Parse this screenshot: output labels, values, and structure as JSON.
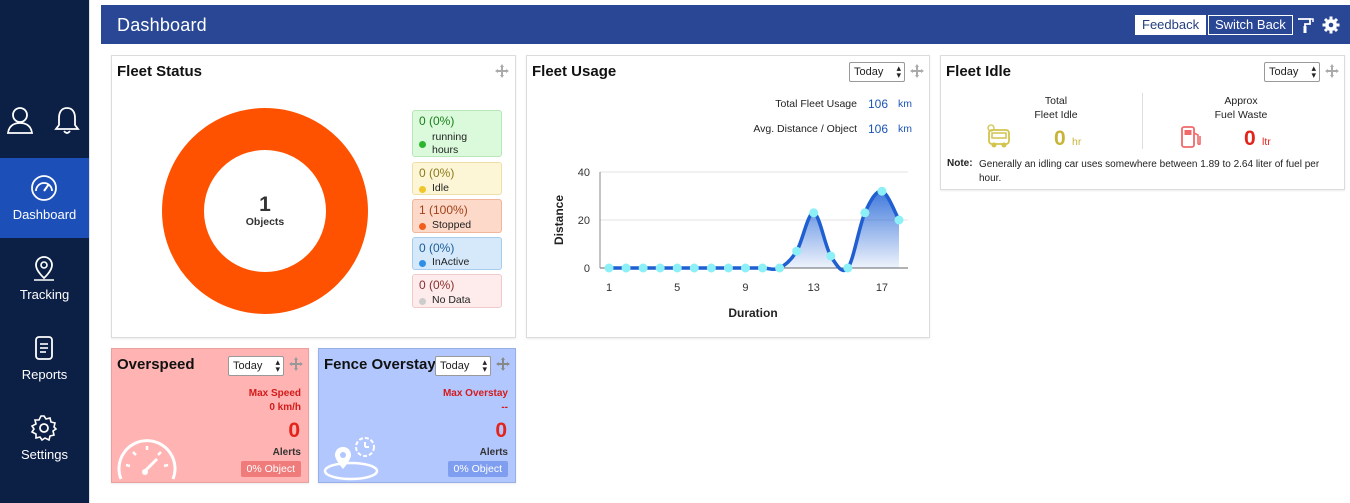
{
  "header": {
    "title": "Dashboard",
    "feedback_label": "Feedback",
    "switch_back_label": "Switch Back"
  },
  "sidebar": {
    "items": [
      {
        "label": "Dashboard",
        "icon": "gauge-icon"
      },
      {
        "label": "Tracking",
        "icon": "map-pin-icon"
      },
      {
        "label": "Reports",
        "icon": "document-icon"
      },
      {
        "label": "Settings",
        "icon": "gear-icon"
      }
    ]
  },
  "fleet_status": {
    "title": "Fleet Status",
    "center_value": "1",
    "center_label": "Objects",
    "legend": [
      {
        "value": "0 (0%)",
        "label": "running hours",
        "color": "#2db52d",
        "bg": "#dafadb"
      },
      {
        "value": "0 (0%)",
        "label": "Idle",
        "color": "#f1c628",
        "bg": "#fdf6d6"
      },
      {
        "value": "1 (100%)",
        "label": "Stopped",
        "color": "#f25d1a",
        "bg": "#fcd9c8"
      },
      {
        "value": "0 (0%)",
        "label": "InActive",
        "color": "#2f8ee8",
        "bg": "#d5e9fb"
      },
      {
        "value": "0 (0%)",
        "label": "No Data",
        "color": "#cccccc",
        "bg": "#fdeceb"
      }
    ]
  },
  "fleet_usage": {
    "title": "Fleet Usage",
    "period": "Today",
    "total_label": "Total Fleet Usage",
    "total_value": "106",
    "avg_label": "Avg. Distance / Object",
    "avg_value": "106",
    "unit": "km"
  },
  "fleet_idle": {
    "title": "Fleet Idle",
    "period": "Today",
    "total_label_1": "Total",
    "total_label_2": "Fleet Idle",
    "total_value": "0",
    "total_unit": "hr",
    "waste_label_1": "Approx",
    "waste_label_2": "Fuel Waste",
    "waste_value": "0",
    "waste_unit": "ltr",
    "note_label": "Note:",
    "note_text": "Generally an idling car uses somewhere between 1.89 to 2.64 liter of fuel per hour."
  },
  "overspeed": {
    "title": "Overspeed",
    "period": "Today",
    "sub_label": "Max Speed",
    "sub_value": "0 km/h",
    "alerts_value": "0",
    "alerts_label": "Alerts",
    "object_pct": "0% Object",
    "bg_color": "#ffb3b3"
  },
  "fence_overstay": {
    "title": "Fence Overstay",
    "period": "Today",
    "sub_label": "Max Overstay",
    "sub_value": "--",
    "alerts_value": "0",
    "alerts_label": "Alerts",
    "object_pct": "0% Object",
    "bg_color": "#b3c7ff"
  },
  "chart_data": {
    "type": "area",
    "xlabel": "Duration",
    "ylabel": "Distance",
    "ylim": [
      0,
      40
    ],
    "yticks": [
      0,
      20,
      40
    ],
    "xticks": [
      1,
      5,
      9,
      13,
      17
    ],
    "xlim": [
      1,
      18
    ],
    "x": [
      1,
      2,
      3,
      4,
      5,
      6,
      7,
      8,
      9,
      10,
      11,
      12,
      13,
      14,
      15,
      16,
      17,
      18
    ],
    "series": [
      {
        "values": [
          0,
          0,
          0,
          0,
          0,
          0,
          0,
          0,
          0,
          0,
          0,
          7,
          23,
          5,
          0,
          23,
          32,
          20
        ]
      }
    ]
  }
}
